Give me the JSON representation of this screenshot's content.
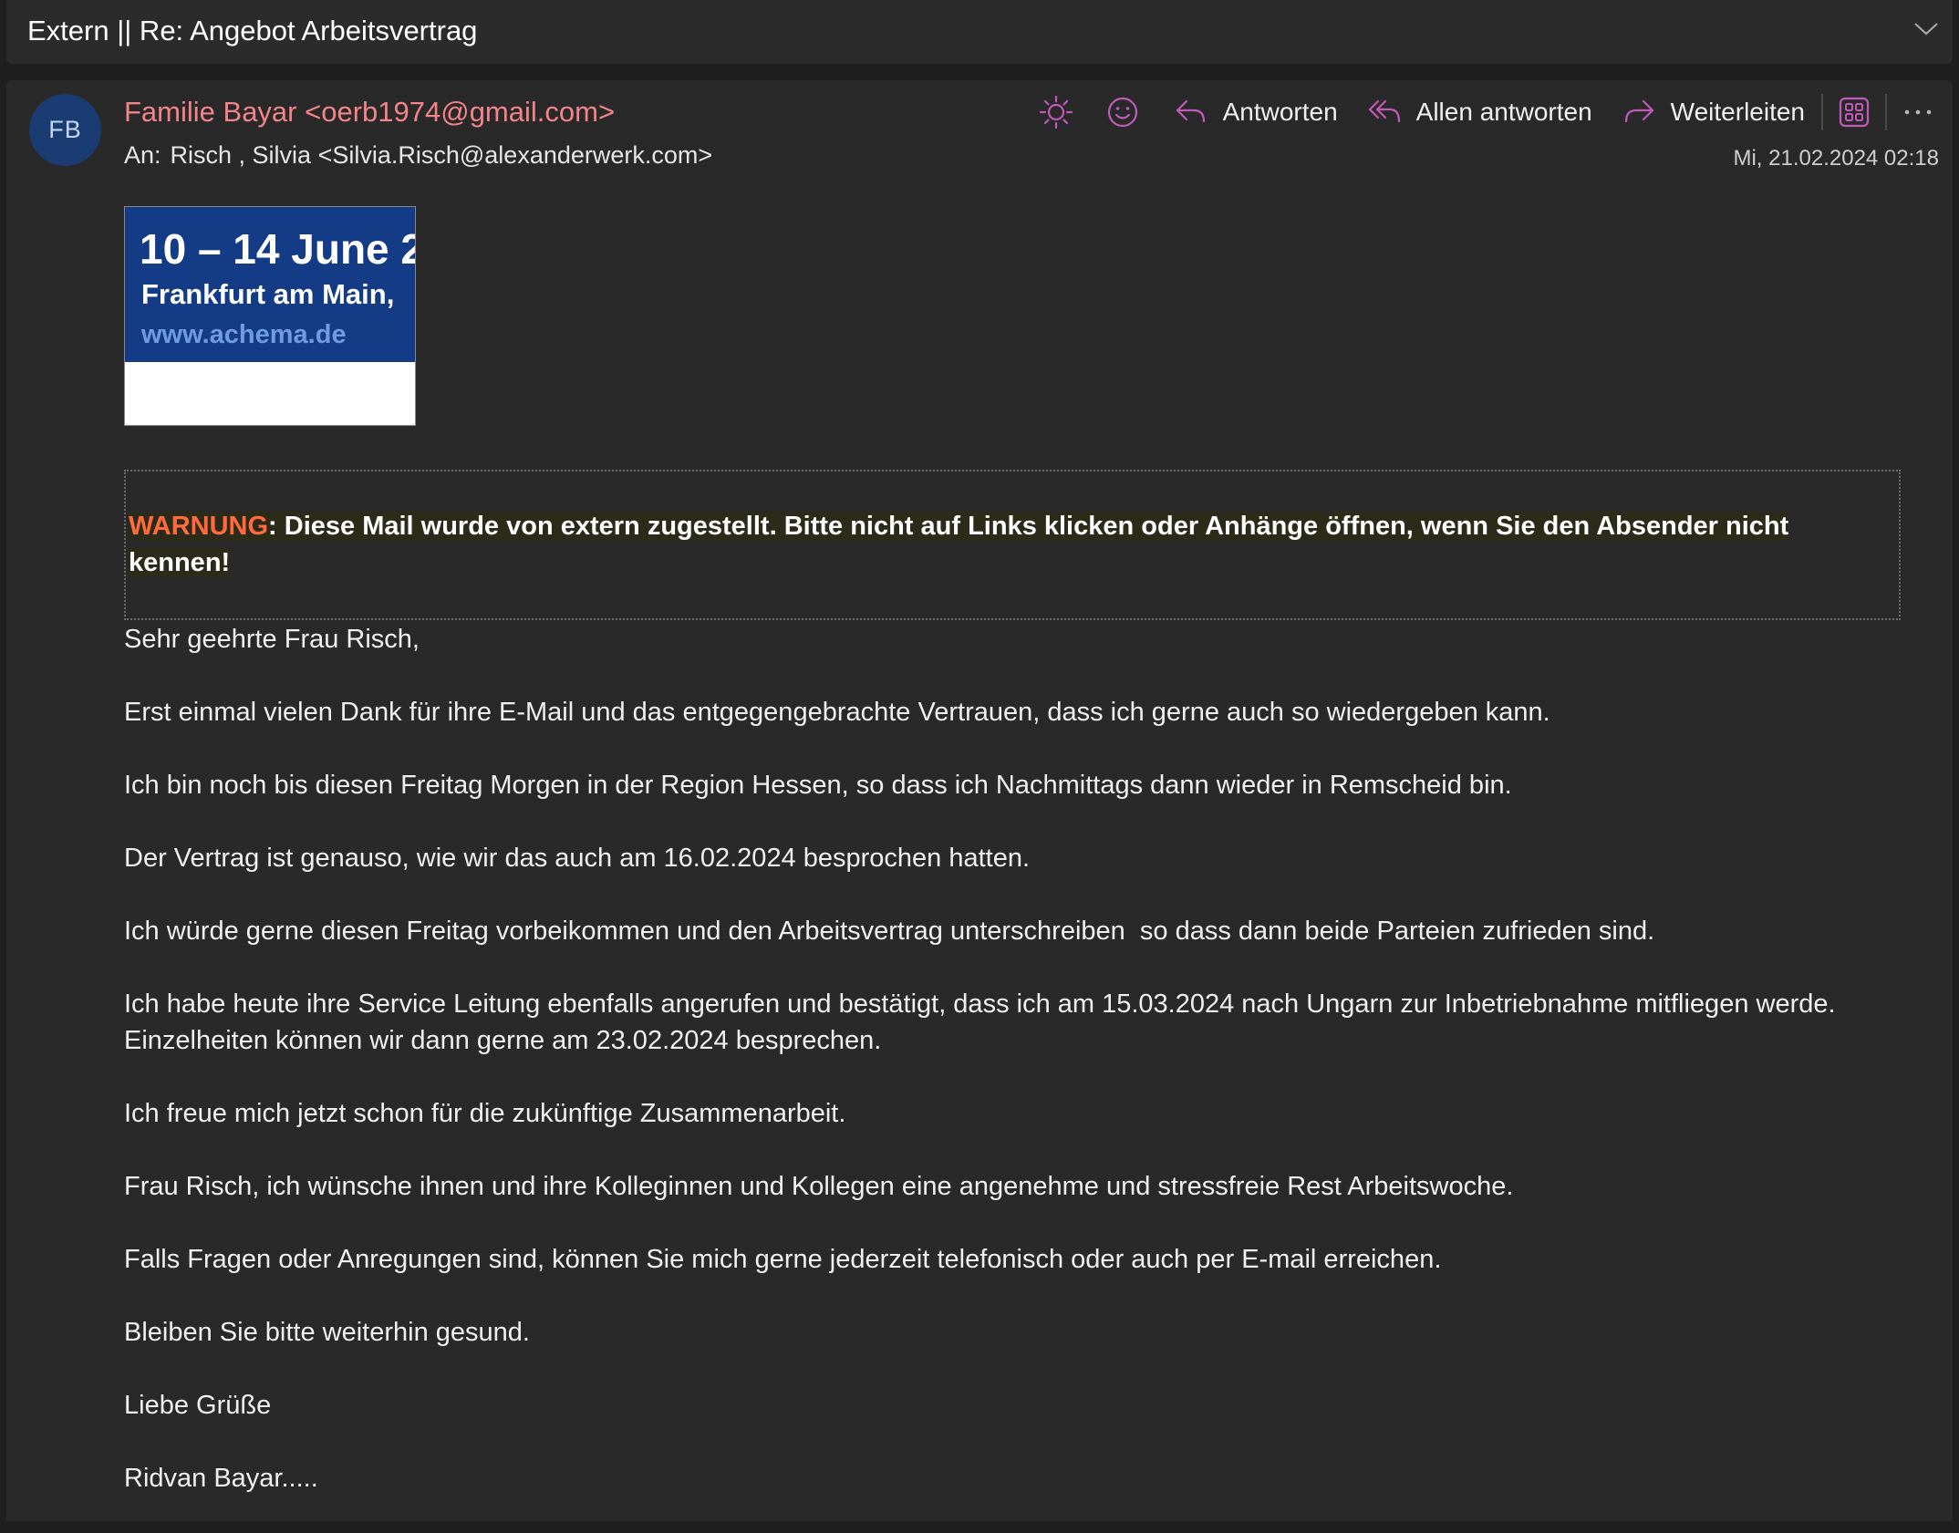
{
  "subject": "Extern || Re: Angebot Arbeitsvertrag",
  "sender": {
    "initials": "FB",
    "display": "Familie Bayar <oerb1974@gmail.com>"
  },
  "recipient": {
    "label": "An:",
    "value": "Risch , Silvia <Silvia.Risch@alexanderwerk.com>"
  },
  "date": "Mi, 21.02.2024 02:18",
  "actions": {
    "reply": "Antworten",
    "reply_all": "Allen antworten",
    "forward": "Weiterleiten"
  },
  "colors": {
    "accent": "#c15ab8",
    "sender": "#f2848a",
    "warning": "#ff6b3d"
  },
  "icons": [
    "brightness-icon",
    "emoji-icon",
    "reply-icon",
    "reply-all-icon",
    "forward-icon",
    "apps-icon",
    "more-icon",
    "chevron-down-icon"
  ],
  "banner": {
    "line1": "10 – 14 June 2",
    "line2": "Frankfurt am Main,",
    "line3": "www.achema.de"
  },
  "warning": {
    "keyword": "WARNUNG",
    "text": ": Diese Mail wurde von extern zugestellt. Bitte nicht auf Links klicken oder Anhänge öffnen, wenn Sie den Absender nicht kennen!"
  },
  "body": {
    "p1": "Sehr geehrte Frau Risch,",
    "p2": "Erst einmal vielen Dank für ihre E-Mail und das entgegengebrachte Vertrauen, dass ich gerne auch so wiedergeben kann.",
    "p3": "Ich bin noch bis diesen Freitag Morgen in der Region Hessen, so dass ich Nachmittags dann wieder in Remscheid bin.",
    "p4": "Der Vertrag ist genauso, wie wir das auch am 16.02.2024 besprochen hatten.",
    "p5": "Ich würde gerne diesen Freitag vorbeikommen und den Arbeitsvertrag unterschreiben  so dass dann beide Parteien zufrieden sind.",
    "p6": "Ich habe heute ihre Service Leitung ebenfalls angerufen und bestätigt, dass ich am 15.03.2024 nach Ungarn zur Inbetriebnahme mitfliegen werde.\nEinzelheiten können wir dann gerne am 23.02.2024 besprechen.",
    "p7": "Ich freue mich jetzt schon für die zukünftige Zusammenarbeit.",
    "p8": "Frau Risch, ich wünsche ihnen und ihre Kolleginnen und Kollegen eine angenehme und stressfreie Rest Arbeitswoche.",
    "p9": "Falls Fragen oder Anregungen sind, können Sie mich gerne jederzeit telefonisch oder auch per E-mail erreichen.",
    "p10": "Bleiben Sie bitte weiterhin gesund.",
    "p11": "Liebe Grüße",
    "p12": "Ridvan Bayar....."
  }
}
